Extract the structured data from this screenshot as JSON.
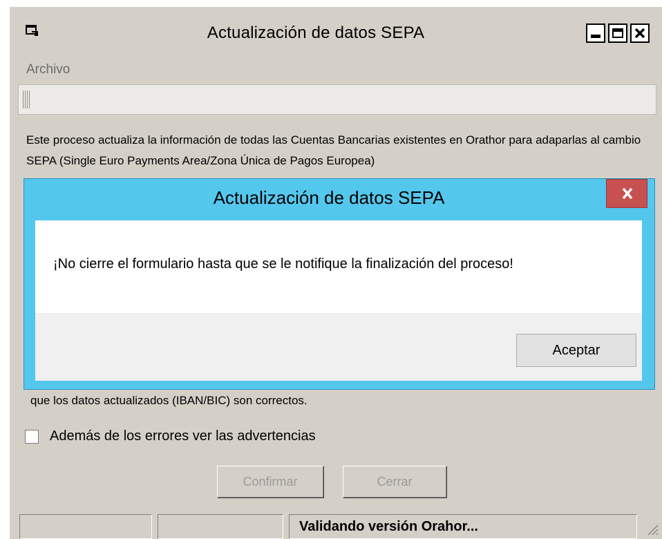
{
  "window": {
    "title": "Actualización de datos SEPA",
    "icon": "app-window-icon",
    "controls": [
      "minimize-icon",
      "maximize-icon",
      "close-icon"
    ]
  },
  "menu": {
    "items": [
      {
        "label": "Archivo"
      }
    ]
  },
  "description": "Este proceso actualiza la información de todas las Cuentas Bancarias existentes en Orathor para adaparlas al cambio SEPA (Single Euro Payments Area/Zona Única de Pagos Europea)",
  "partial_text": "que los datos actualizados (IBAN/BIC) son correctos.",
  "checkbox": {
    "label": "Además de los errores ver las advertencias",
    "checked": false
  },
  "buttons": {
    "confirm": "Confirmar",
    "close": "Cerrar"
  },
  "statusbar": {
    "panels": [
      "",
      "",
      "Validando versión Orahor..."
    ]
  },
  "dialog": {
    "title": "Actualización de datos SEPA",
    "message": "¡No cierre el formulario hasta que se le notifique la finalización del proceso!",
    "ok_button": "Aceptar"
  },
  "colors": {
    "window_bg": "#d4d0c8",
    "dialog_frame": "#54c7ed",
    "dialog_close": "#c75050"
  }
}
